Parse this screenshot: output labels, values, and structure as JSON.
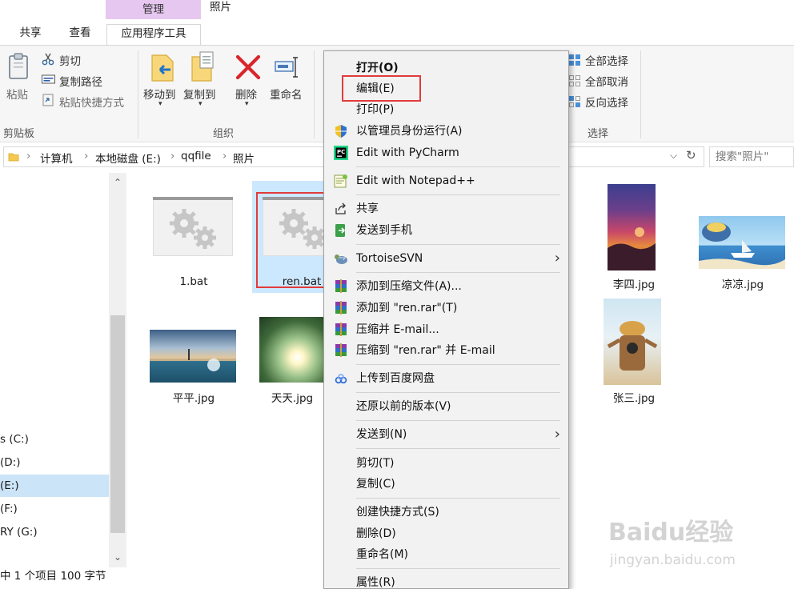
{
  "ribbon": {
    "context_tab_header": "管理",
    "context_tab_title": "照片",
    "tabs": [
      {
        "label": "共享"
      },
      {
        "label": "查看"
      },
      {
        "label": "应用程序工具"
      }
    ],
    "clipboard": {
      "paste": "粘贴",
      "cut": "剪切",
      "copy_path": "复制路径",
      "paste_shortcut": "粘贴快捷方式",
      "group_label": "剪贴板"
    },
    "organize": {
      "move_to": "移动到",
      "copy_to": "复制到",
      "delete": "删除",
      "rename": "重命名",
      "group_label": "组织"
    },
    "select": {
      "select_all": "全部选择",
      "select_none": "全部取消",
      "invert": "反向选择",
      "group_label": "选择"
    }
  },
  "address": {
    "crumbs": [
      "计算机",
      "本地磁盘 (E:)",
      "qqfile",
      "照片"
    ],
    "search_placeholder": "搜索\"照片\""
  },
  "nav": {
    "drives": [
      "s (C:)",
      "(D:)",
      "(E:)",
      "(F:)",
      "RY (G:)"
    ]
  },
  "files": [
    {
      "name": "1.bat"
    },
    {
      "name": "ren.bat"
    },
    {
      "name": "李四.jpg"
    },
    {
      "name": "凉凉.jpg"
    },
    {
      "name": "平平.jpg"
    },
    {
      "name": "天天.jpg"
    },
    {
      "name": "张三.jpg"
    }
  ],
  "status": {
    "text": "中 1 个项目  100 字节"
  },
  "context_menu": {
    "items": [
      {
        "label": "打开(O)",
        "bold": true
      },
      {
        "label": "编辑(E)"
      },
      {
        "label": "打印(P)"
      },
      {
        "label": "以管理员身份运行(A)",
        "icon": "shield-icon"
      },
      {
        "label": "Edit with PyCharm",
        "icon": "pycharm-icon"
      },
      {
        "label": "Edit with Notepad++",
        "icon": "notepad-plus-icon"
      },
      {
        "label": "共享",
        "icon": "share-icon"
      },
      {
        "label": "发送到手机",
        "icon": "send-to-phone-icon"
      },
      {
        "label": "TortoiseSVN",
        "icon": "tortoisesvn-icon"
      },
      {
        "label": "添加到压缩文件(A)...",
        "icon": "winrar-icon"
      },
      {
        "label": "添加到 \"ren.rar\"(T)",
        "icon": "winrar-icon"
      },
      {
        "label": "压缩并 E-mail...",
        "icon": "winrar-icon"
      },
      {
        "label": "压缩到 \"ren.rar\" 并 E-mail",
        "icon": "winrar-icon"
      },
      {
        "label": "上传到百度网盘",
        "icon": "baidu-netdisk-icon"
      },
      {
        "label": "还原以前的版本(V)"
      },
      {
        "label": "发送到(N)"
      },
      {
        "label": "剪切(T)"
      },
      {
        "label": "复制(C)"
      },
      {
        "label": "创建快捷方式(S)"
      },
      {
        "label": "删除(D)"
      },
      {
        "label": "重命名(M)"
      },
      {
        "label": "属性(R)"
      }
    ]
  },
  "watermark": {
    "logo": "Baidu经验",
    "url": "jingyan.baidu.com"
  },
  "colors": {
    "highlight_box": "#e23b3b",
    "manage_tab": "#e6c7f0",
    "selection": "#cce8ff"
  }
}
